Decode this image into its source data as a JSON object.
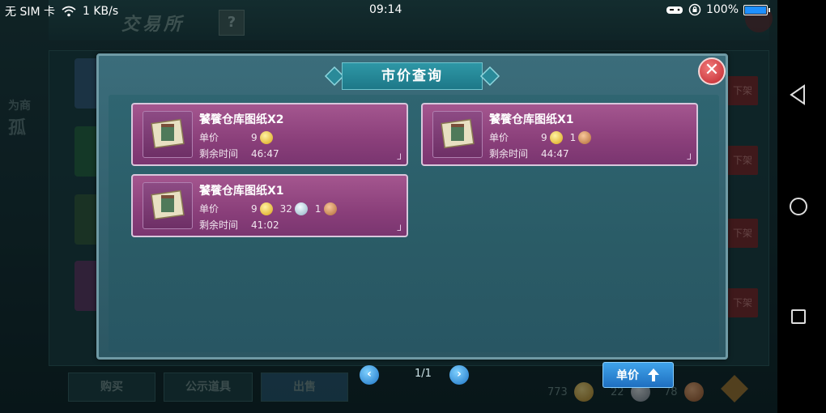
{
  "status_bar": {
    "sim": "无 SIM 卡",
    "speed": "1 KB/s",
    "time": "09:14",
    "battery": "100%",
    "battery_level": 1.0
  },
  "background": {
    "title": "交易所",
    "help": "?",
    "unshelf_label": "下架",
    "tabs": [
      "购买",
      "公示道具",
      "出售"
    ],
    "currency": {
      "gold": "773",
      "silver": "22",
      "copper": "78"
    }
  },
  "modal": {
    "title": "市价查询",
    "close": "✕",
    "price_label": "单价",
    "time_label": "剩余时间",
    "items": [
      {
        "name": "饕餮仓库图纸X2",
        "gold": "9",
        "silver": "",
        "copper": "",
        "time": "46:47"
      },
      {
        "name": "饕餮仓库图纸X1",
        "gold": "9",
        "silver": "",
        "copper": "1",
        "time": "44:47"
      },
      {
        "name": "饕餮仓库图纸X1",
        "gold": "9",
        "silver": "32",
        "copper": "1",
        "time": "41:02"
      }
    ],
    "pager": {
      "prev": "‹",
      "next": "›",
      "indicator": "1/1"
    },
    "sort_button": "单价"
  },
  "colors": {
    "accent": "#2f95e0",
    "card": "#8a3f7a",
    "close": "#c0262d"
  }
}
